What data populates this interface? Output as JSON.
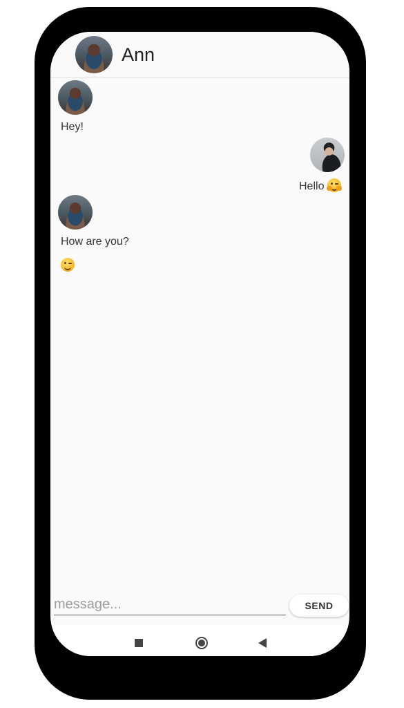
{
  "header": {
    "contact_name": "Ann"
  },
  "messages": [
    {
      "from": "Ann",
      "text": "Hey!"
    },
    {
      "from": "me",
      "text": "Hello",
      "emoji": "hugging-face-emoji"
    },
    {
      "from": "Ann",
      "text": "How are you?"
    },
    {
      "from": "Ann",
      "emoji": "winking-face-emoji"
    }
  ],
  "composer": {
    "placeholder": "message...",
    "value": "",
    "send_label": "SEND"
  },
  "navbar": {
    "items": [
      "recents-button",
      "home-button",
      "back-button"
    ]
  }
}
